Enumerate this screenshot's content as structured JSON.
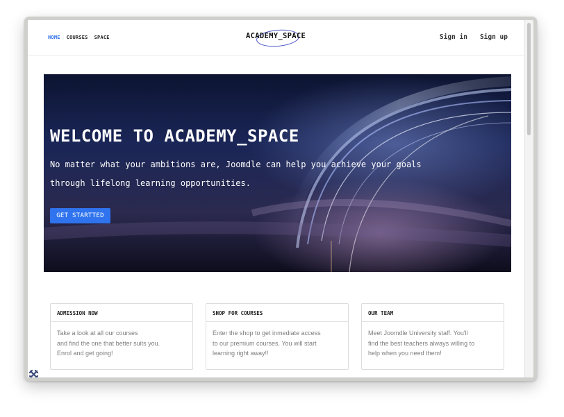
{
  "nav": {
    "items": [
      {
        "label": "HOME",
        "active": true
      },
      {
        "label": "COURSES",
        "active": false
      },
      {
        "label": "SPACE",
        "active": false
      }
    ]
  },
  "brand": {
    "title": "ACADEMY_SPACE"
  },
  "auth": {
    "sign_in": "Sign in",
    "sign_up": "Sign up"
  },
  "hero": {
    "title": "WELCOME TO ACADEMY_SPACE",
    "lines": [
      "No matter what your ambitions are,  Joomdle can help you achieve your goals",
      "through lifelong learning opportunities."
    ],
    "button_label": "GET STARTTED"
  },
  "cards": [
    {
      "title": "ADMISSION NOW",
      "lines": [
        "Take a look at all our courses",
        "and find the one that better suits you.",
        "Enrol and get going!"
      ]
    },
    {
      "title": "SHOP FOR COURSES",
      "lines": [
        "Enter the shop to get inmediate access",
        "to our premium courses. You will start",
        "learning right away!!"
      ]
    },
    {
      "title": "OUR TEAM",
      "lines": [
        "Meet Joomdle University staff. You'll",
        "find the best teachers always willing to",
        "help when you need them!"
      ]
    }
  ],
  "colors": {
    "accent": "#2d6fe8",
    "button": "#2f74ee"
  },
  "icons": {
    "corner": "joomla-icon"
  }
}
